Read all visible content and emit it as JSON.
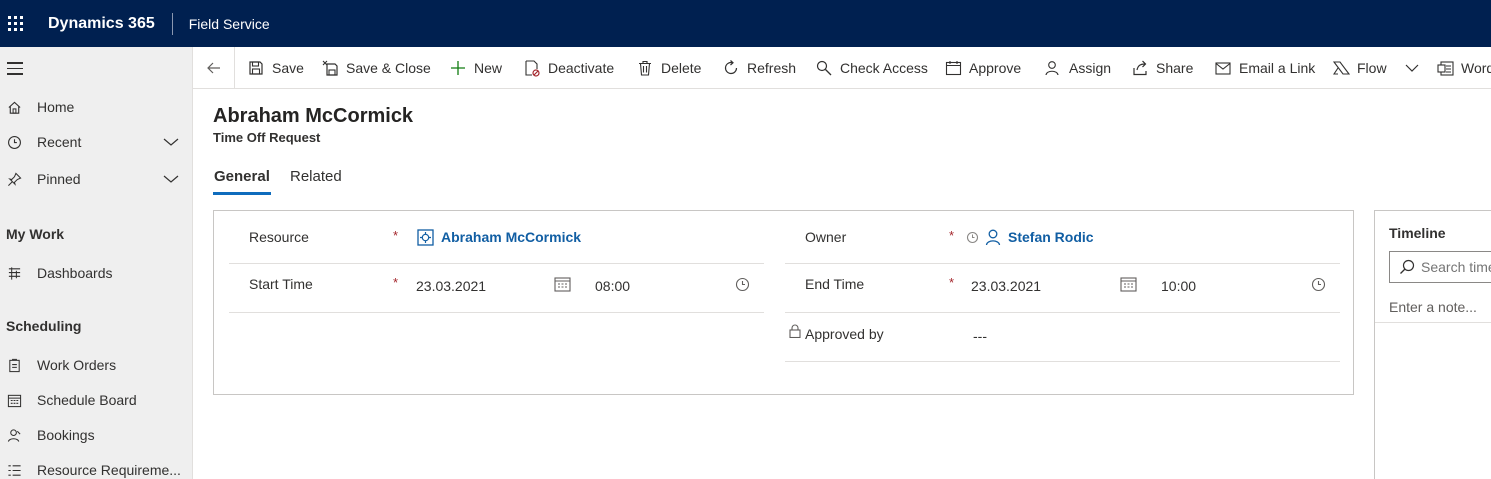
{
  "topbar": {
    "app_title": "Dynamics 365",
    "module": "Field Service"
  },
  "nav": {
    "items": [
      {
        "label": "Home",
        "icon": "home-icon"
      },
      {
        "label": "Recent",
        "icon": "clock-icon"
      },
      {
        "label": "Pinned",
        "icon": "pin-icon"
      },
      {
        "label": "Dashboards",
        "icon": "dashboard-icon"
      },
      {
        "label": "Work Orders",
        "icon": "clipboard-icon"
      },
      {
        "label": "Schedule Board",
        "icon": "calendar-icon"
      },
      {
        "label": "Bookings",
        "icon": "person-icon"
      },
      {
        "label": "Resource Requireme...",
        "icon": "list-icon"
      }
    ],
    "groups": [
      "My Work",
      "Scheduling"
    ]
  },
  "commands": [
    {
      "label": "Save",
      "icon": "save-icon"
    },
    {
      "label": "Save & Close",
      "icon": "save-close-icon"
    },
    {
      "label": "New",
      "icon": "plus-icon"
    },
    {
      "label": "Deactivate",
      "icon": "deactivate-icon"
    },
    {
      "label": "Delete",
      "icon": "trash-icon"
    },
    {
      "label": "Refresh",
      "icon": "refresh-icon"
    },
    {
      "label": "Check Access",
      "icon": "check-access-icon"
    },
    {
      "label": "Approve",
      "icon": "approve-icon"
    },
    {
      "label": "Assign",
      "icon": "assign-icon"
    },
    {
      "label": "Share",
      "icon": "share-icon"
    },
    {
      "label": "Email a Link",
      "icon": "email-icon"
    },
    {
      "label": "Flow",
      "icon": "flow-icon"
    },
    {
      "label": "Word",
      "icon": "word-icon"
    }
  ],
  "header": {
    "title": "Abraham McCormick",
    "subtitle": "Time Off Request"
  },
  "tabs": {
    "general": "General",
    "related": "Related"
  },
  "form": {
    "resource_label": "Resource",
    "resource_value": "Abraham McCormick",
    "owner_label": "Owner",
    "owner_value": "Stefan Rodic",
    "start_label": "Start Time",
    "start_date": "23.03.2021",
    "start_time": "08:00",
    "end_label": "End Time",
    "end_date": "23.03.2021",
    "end_time": "10:00",
    "approved_label": "Approved by",
    "approved_value": "---",
    "required_mark": "*"
  },
  "timeline": {
    "title": "Timeline",
    "search_placeholder": "Search timeline",
    "note_placeholder": "Enter a note..."
  },
  "colors": {
    "topbar": "#002050",
    "link": "#115ea3",
    "accent": "#0f6cbd",
    "required": "#a4262c"
  }
}
